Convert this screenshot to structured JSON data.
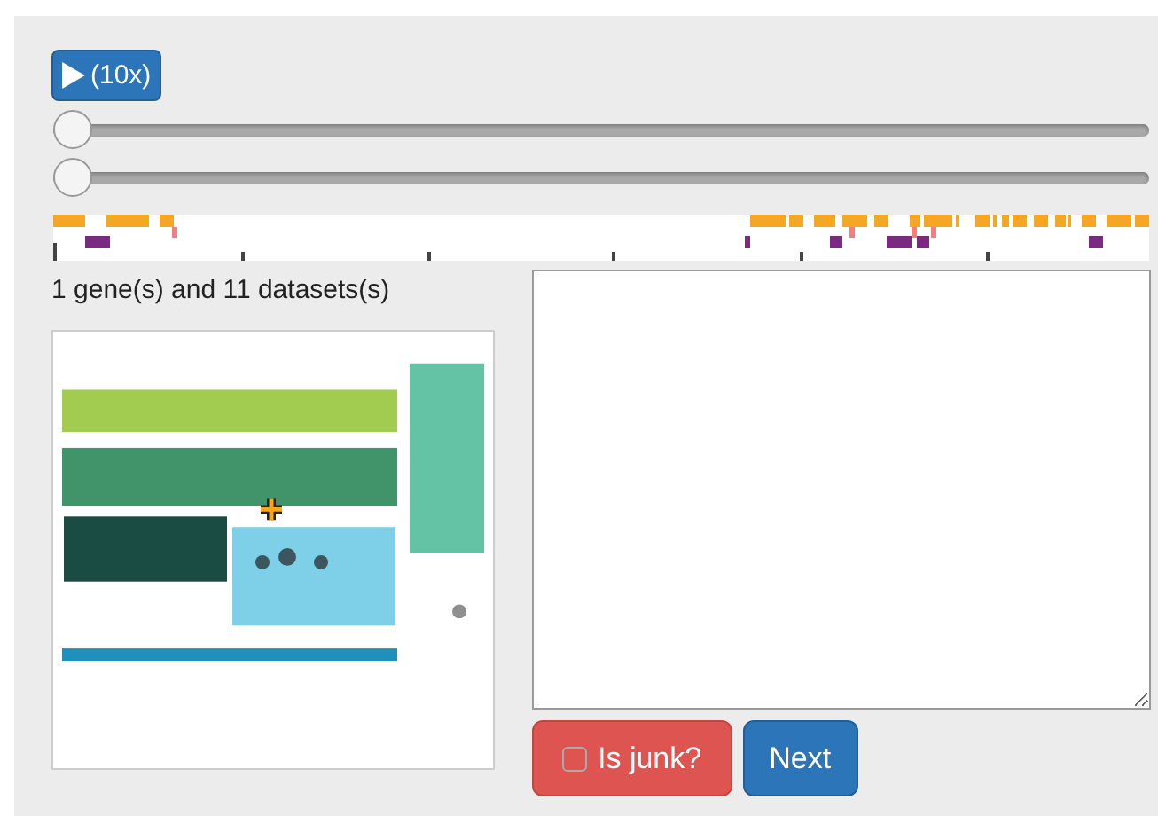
{
  "play_button": {
    "label": "(10x)"
  },
  "sliders": [
    {
      "level": 0
    },
    {
      "level": 0
    }
  ],
  "summary": "1 gene(s) and 11 datasets(s)",
  "junk": {
    "label": "Is junk?",
    "checked": false
  },
  "next_button": {
    "label": "Next"
  }
}
